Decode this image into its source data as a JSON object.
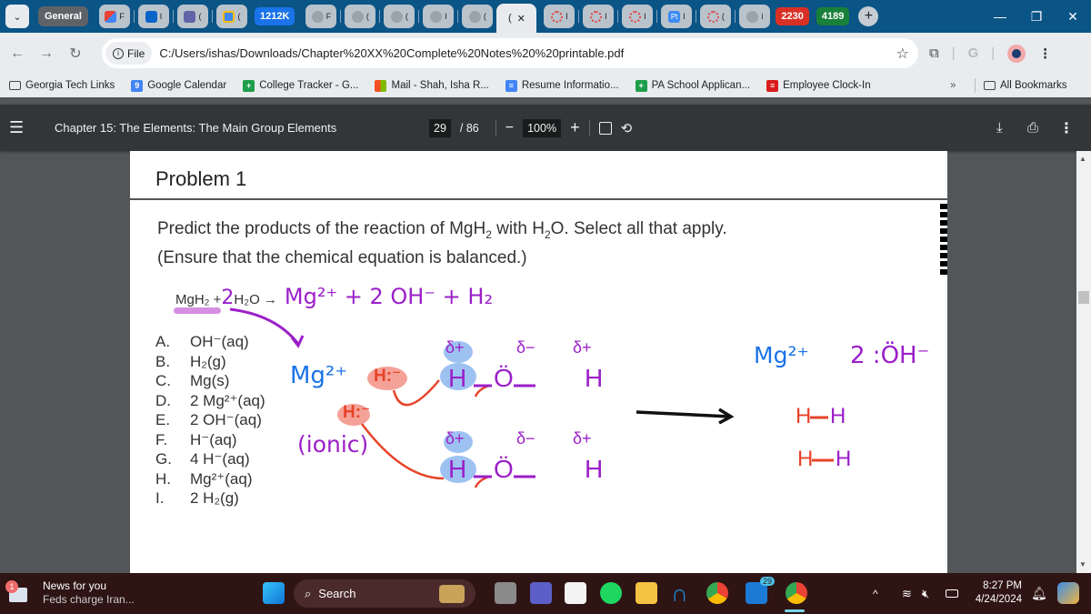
{
  "browser": {
    "tab_group_label": "General",
    "pinned_tabs": [
      {
        "icon": "gmail-icon",
        "label": "F"
      },
      {
        "icon": "outlook-icon",
        "label": "I"
      },
      {
        "icon": "teams-icon",
        "label": "("
      },
      {
        "icon": "calendar-icon",
        "label": "("
      }
    ],
    "group_pill_1212k": "1212K",
    "grey_tabs": [
      {
        "icon": "globe-icon",
        "label": "F"
      },
      {
        "icon": "globe-icon",
        "label": "("
      },
      {
        "icon": "globe-icon",
        "label": "("
      },
      {
        "icon": "globe-icon",
        "label": "I"
      },
      {
        "icon": "globe-icon",
        "label": "("
      }
    ],
    "active_tab_label": "(",
    "right_tabs": [
      {
        "icon": "canvas-icon",
        "label": "I"
      },
      {
        "icon": "canvas-icon",
        "label": "I"
      },
      {
        "icon": "canvas-icon",
        "label": "I"
      },
      {
        "icon": "pt-icon",
        "label": "I",
        "badge": "Pt"
      },
      {
        "icon": "canvas-icon",
        "label": "("
      },
      {
        "icon": "globe-icon",
        "label": "i"
      }
    ],
    "group_pill_2230": "2230",
    "group_pill_4189": "4189",
    "new_tab_symbol": "+",
    "url_scheme_chip": "File",
    "url": "C:/Users/ishas/Downloads/Chapter%20XX%20Complete%20Notes%20%20printable.pdf",
    "bookmarks": [
      {
        "label": "Georgia Tech Links",
        "icon": "folder-icon"
      },
      {
        "label": "Google Calendar",
        "icon": "calendar-icon",
        "badge": "9"
      },
      {
        "label": "College Tracker - G...",
        "icon": "sheets-icon"
      },
      {
        "label": "Mail - Shah, Isha R...",
        "icon": "microsoft-icon"
      },
      {
        "label": "Resume Informatio...",
        "icon": "docs-icon"
      },
      {
        "label": "PA School Applican...",
        "icon": "sheets-icon"
      },
      {
        "label": "Employee Clock-In",
        "icon": "clock-in-icon"
      }
    ],
    "bookmarks_overflow": "»",
    "all_bookmarks": "All Bookmarks",
    "colors": {
      "tabbar": "#0b5486",
      "pill_blue": "#1a73e8",
      "pill_red": "#d93025",
      "pill_green": "#188038"
    }
  },
  "pdf": {
    "title": "Chapter 15: The Elements: The Main Group Elements",
    "page_current": "29",
    "page_total": "/ 86",
    "zoom": "100%"
  },
  "document": {
    "heading": "Problem 1",
    "prompt_line1": "Predict the products of the reaction of MgH",
    "prompt_sub1": "2",
    "prompt_mid": " with H",
    "prompt_sub2": "2",
    "prompt_end": "O. Select all that apply.",
    "prompt_line2": "(Ensure that the chemical equation is balanced.)",
    "equation_typed": "MgH₂ + ",
    "equation_hand_2": "2",
    "equation_typed_2": " H₂O →",
    "equation_products": "Mg²⁺ + 2 OH⁻ + H₂",
    "options": [
      {
        "letter": "A.",
        "text": "OH⁻(aq)"
      },
      {
        "letter": "B.",
        "text": "H₂(g)"
      },
      {
        "letter": "C.",
        "text": "Mg(s)"
      },
      {
        "letter": "D.",
        "text": "2 Mg²⁺(aq)"
      },
      {
        "letter": "E.",
        "text": "2 OH⁻(aq)"
      },
      {
        "letter": "F.",
        "text": "H⁻(aq)"
      },
      {
        "letter": "G.",
        "text": "4 H⁻(aq)"
      },
      {
        "letter": "H.",
        "text": "Mg²⁺(aq)"
      },
      {
        "letter": "I.",
        "text": "2 H₂(g)"
      }
    ],
    "annotations": {
      "mg_ion": "Mg²⁺",
      "hydride": "H:⁻",
      "ionic": "(ionic)",
      "delta_plus": "δ+",
      "delta_minus": "δ−",
      "water_h": "H",
      "water_o": "Ö",
      "product_mg": "Mg²⁺",
      "product_oh": "2 :ÖH⁻",
      "h_h_left": "H",
      "h_h_right": "H"
    },
    "colors": {
      "purple": "#9b1fc9",
      "blue": "#1a73e8",
      "red": "#e8432b",
      "pink_highlight": "#d58fe0"
    }
  },
  "taskbar": {
    "news_title": "News for you",
    "news_subtitle": "Feds charge Iran...",
    "news_badge": "1",
    "search_label": "Search",
    "notif_badge": "29",
    "time": "8:27 PM",
    "date": "4/24/2024"
  }
}
